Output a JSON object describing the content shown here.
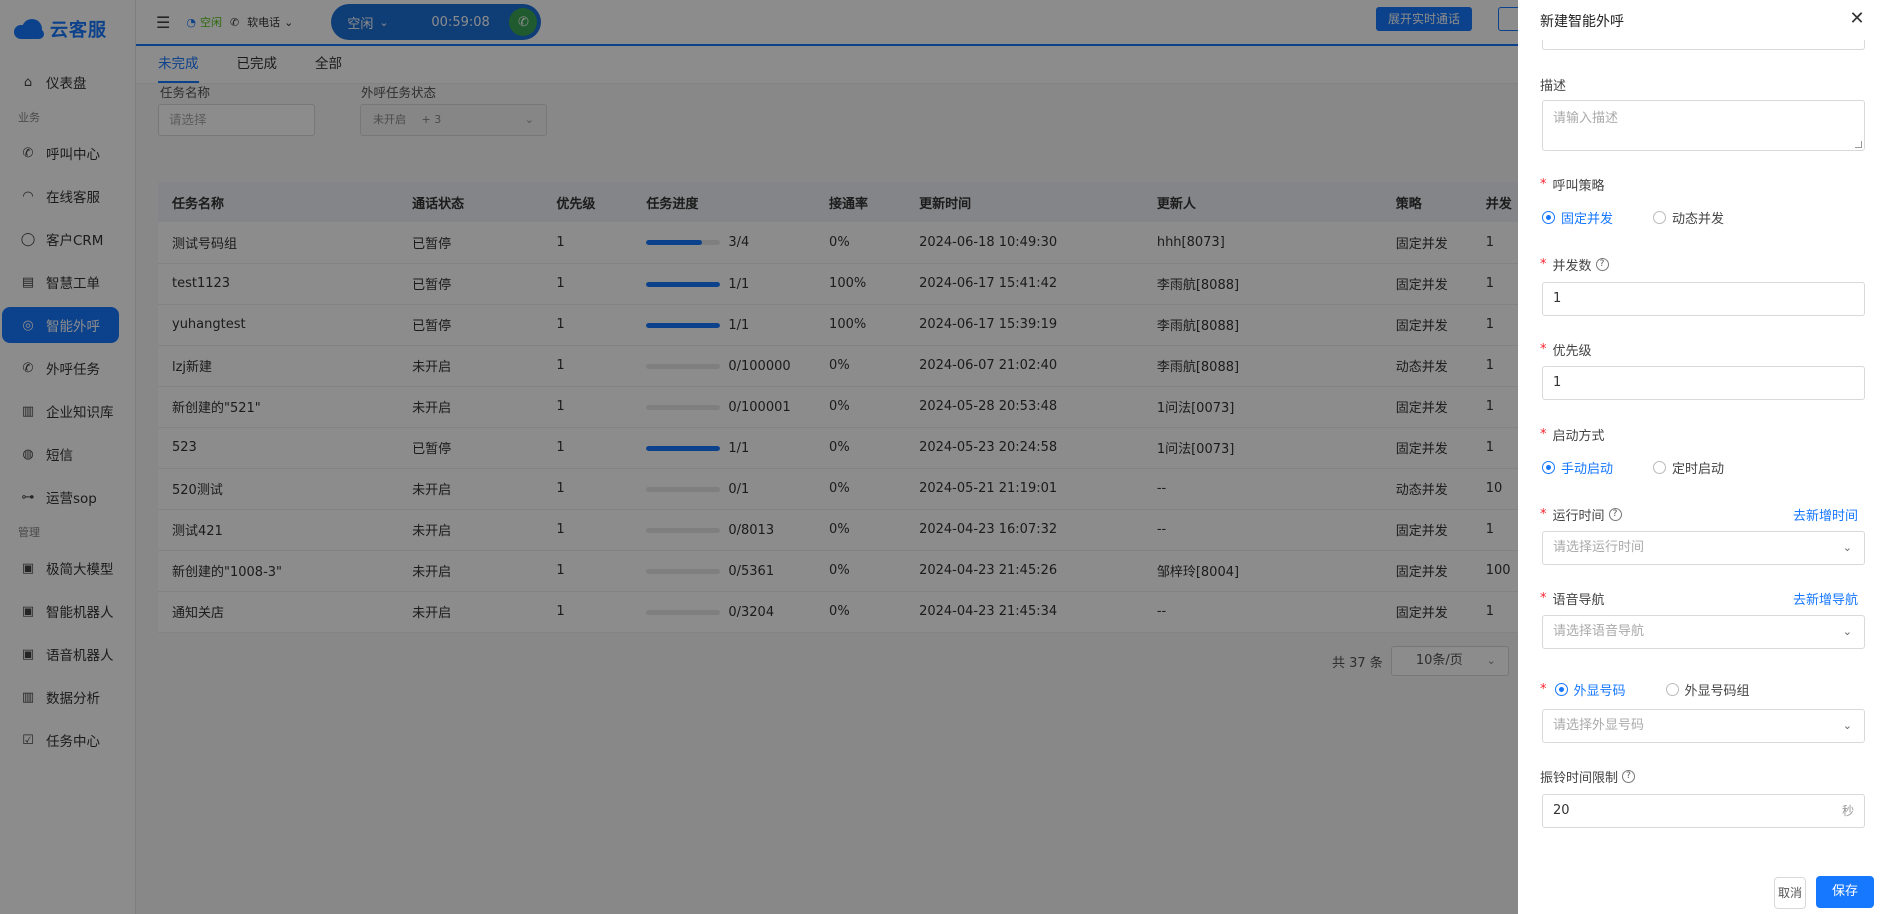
{
  "app": {
    "name": "云客服"
  },
  "sidebar": {
    "items": [
      {
        "label": "仪表盘",
        "icon": "home-icon"
      },
      {
        "group": "业务"
      },
      {
        "label": "呼叫中心",
        "icon": "phone-icon"
      },
      {
        "label": "在线客服",
        "icon": "headset-icon"
      },
      {
        "label": "客户CRM",
        "icon": "user-icon"
      },
      {
        "label": "智慧工单",
        "icon": "ticket-icon"
      },
      {
        "label": "智能外呼",
        "icon": "outbound-icon",
        "active": true
      },
      {
        "label": "外呼任务",
        "icon": "phone-task-icon"
      },
      {
        "label": "企业知识库",
        "icon": "book-icon"
      },
      {
        "label": "短信",
        "icon": "sms-icon"
      },
      {
        "label": "运营sop",
        "icon": "flow-icon"
      },
      {
        "group": "管理"
      },
      {
        "label": "极简大模型",
        "icon": "model-icon"
      },
      {
        "label": "智能机器人",
        "icon": "robot-icon"
      },
      {
        "label": "语音机器人",
        "icon": "voice-robot-icon"
      },
      {
        "label": "数据分析",
        "icon": "chart-icon"
      },
      {
        "label": "任务中心",
        "icon": "checklist-icon"
      }
    ]
  },
  "topbar": {
    "agent_status": "空闲",
    "softphone": "软电话",
    "call_state": "空闲",
    "call_timer": "00:59:08",
    "expand_button": "展开实时通话"
  },
  "main": {
    "tabs": [
      "未完成",
      "已完成",
      "全部"
    ],
    "filters": {
      "task_name_label": "任务名称",
      "task_name_placeholder": "请选择",
      "status_label": "外呼任务状态",
      "status_value": "未开启",
      "status_more": "+ 3"
    },
    "table": {
      "columns": [
        "任务名称",
        "通话状态",
        "优先级",
        "任务进度",
        "接通率",
        "更新时间",
        "更新人",
        "策略",
        "并发"
      ],
      "rows": [
        {
          "name": "测试号码组",
          "status": "已暂停",
          "priority": "1",
          "progress": "3/4",
          "progress_fraction": 0.75,
          "rate": "0%",
          "updated": "2024-06-18 10:49:30",
          "updater": "hhh[8073]",
          "strategy": "固定并发",
          "concurrency": "1"
        },
        {
          "name": "test1123",
          "status": "已暂停",
          "priority": "1",
          "progress": "1/1",
          "progress_fraction": 1,
          "rate": "100%",
          "updated": "2024-06-17 15:41:42",
          "updater": "李雨航[8088]",
          "strategy": "固定并发",
          "concurrency": "1"
        },
        {
          "name": "yuhangtest",
          "status": "已暂停",
          "priority": "1",
          "progress": "1/1",
          "progress_fraction": 1,
          "rate": "100%",
          "updated": "2024-06-17 15:39:19",
          "updater": "李雨航[8088]",
          "strategy": "固定并发",
          "concurrency": "1"
        },
        {
          "name": "lzj新建",
          "status": "未开启",
          "priority": "1",
          "progress": "0/100000",
          "progress_fraction": 0,
          "rate": "0%",
          "updated": "2024-06-07 21:02:40",
          "updater": "李雨航[8088]",
          "strategy": "动态并发",
          "concurrency": "1"
        },
        {
          "name": "新创建的\"521\"",
          "status": "未开启",
          "priority": "1",
          "progress": "0/100001",
          "progress_fraction": 0,
          "rate": "0%",
          "updated": "2024-05-28 20:53:48",
          "updater": "1问法[0073]",
          "strategy": "固定并发",
          "concurrency": "1"
        },
        {
          "name": "523",
          "status": "已暂停",
          "priority": "1",
          "progress": "1/1",
          "progress_fraction": 1,
          "rate": "0%",
          "updated": "2024-05-23 20:24:58",
          "updater": "1问法[0073]",
          "strategy": "固定并发",
          "concurrency": "1"
        },
        {
          "name": "520测试",
          "status": "未开启",
          "priority": "1",
          "progress": "0/1",
          "progress_fraction": 0,
          "rate": "0%",
          "updated": "2024-05-21 21:19:01",
          "updater": "--",
          "strategy": "动态并发",
          "concurrency": "10"
        },
        {
          "name": "测试421",
          "status": "未开启",
          "priority": "1",
          "progress": "0/8013",
          "progress_fraction": 0,
          "rate": "0%",
          "updated": "2024-04-23 16:07:32",
          "updater": "--",
          "strategy": "固定并发",
          "concurrency": "1"
        },
        {
          "name": "新创建的\"1008-3\"",
          "status": "未开启",
          "priority": "1",
          "progress": "0/5361",
          "progress_fraction": 0,
          "rate": "0%",
          "updated": "2024-04-23 21:45:26",
          "updater": "邹梓玲[8004]",
          "strategy": "固定并发",
          "concurrency": "100"
        },
        {
          "name": "通知关店",
          "status": "未开启",
          "priority": "1",
          "progress": "0/3204",
          "progress_fraction": 0,
          "rate": "0%",
          "updated": "2024-04-23 21:45:34",
          "updater": "--",
          "strategy": "固定并发",
          "concurrency": "1"
        }
      ]
    },
    "pager": {
      "total": "共 37 条",
      "page_size": "10条/页"
    }
  },
  "drawer": {
    "title": "新建智能外呼",
    "description_label": "描述",
    "description_placeholder": "请输入描述",
    "strategy_label": "呼叫策略",
    "strategy_options": [
      "固定并发",
      "动态并发"
    ],
    "strategy_selected": 0,
    "concurrency_label": "并发数",
    "concurrency_value": "1",
    "priority_label": "优先级",
    "priority_value": "1",
    "start_label": "启动方式",
    "start_options": [
      "手动启动",
      "定时启动"
    ],
    "start_selected": 0,
    "runtime_label": "运行时间",
    "runtime_link": "去新增时间",
    "runtime_placeholder": "请选择运行时间",
    "ivr_label": "语音导航",
    "ivr_link": "去新增导航",
    "ivr_placeholder": "请选择语音导航",
    "display_options": [
      "外显号码",
      "外显号码组"
    ],
    "display_selected": 0,
    "display_placeholder": "请选择外显号码",
    "ring_label": "振铃时间限制",
    "ring_value": "20",
    "ring_unit": "秒",
    "cancel": "取消",
    "save": "保存"
  },
  "colors": {
    "primary": "#1677ff",
    "success": "#52c41a",
    "required": "#f5222d"
  }
}
